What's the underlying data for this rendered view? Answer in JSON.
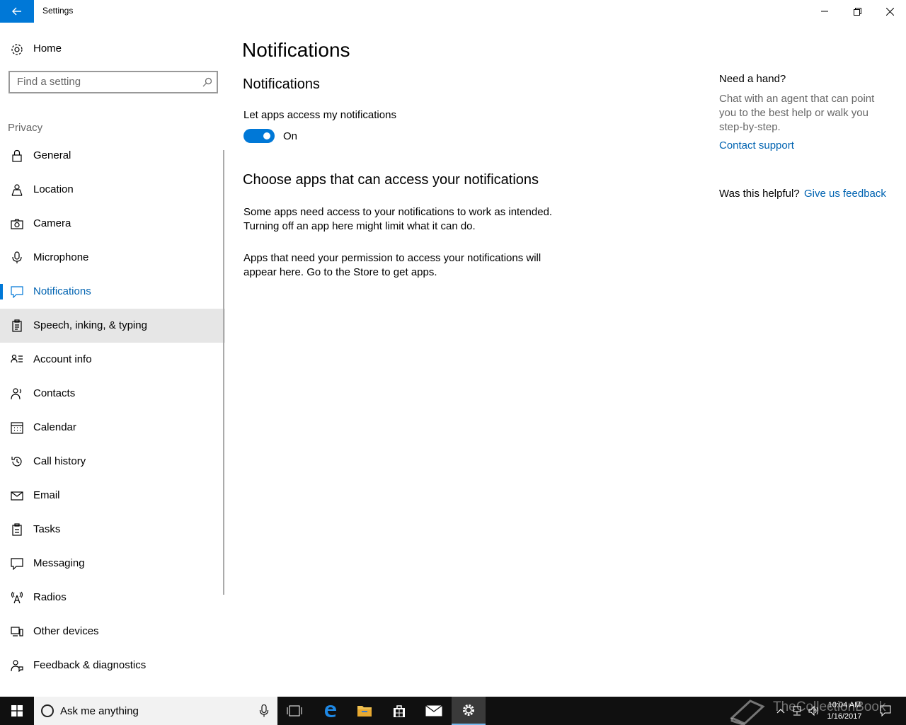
{
  "window": {
    "title": "Settings"
  },
  "sidebar": {
    "home_label": "Home",
    "search_placeholder": "Find a setting",
    "section_label": "Privacy",
    "items": [
      {
        "label": "General",
        "icon": "lock-icon"
      },
      {
        "label": "Location",
        "icon": "location-person-icon"
      },
      {
        "label": "Camera",
        "icon": "camera-icon"
      },
      {
        "label": "Microphone",
        "icon": "microphone-icon"
      },
      {
        "label": "Notifications",
        "icon": "speech-bubble-icon",
        "selected": true
      },
      {
        "label": "Speech, inking, & typing",
        "icon": "clipboard-icon",
        "hover": true
      },
      {
        "label": "Account info",
        "icon": "account-info-icon"
      },
      {
        "label": "Contacts",
        "icon": "contacts-icon"
      },
      {
        "label": "Calendar",
        "icon": "calendar-icon"
      },
      {
        "label": "Call history",
        "icon": "history-icon"
      },
      {
        "label": "Email",
        "icon": "mail-icon"
      },
      {
        "label": "Tasks",
        "icon": "tasks-icon"
      },
      {
        "label": "Messaging",
        "icon": "message-icon"
      },
      {
        "label": "Radios",
        "icon": "radio-tower-icon"
      },
      {
        "label": "Other devices",
        "icon": "devices-icon"
      },
      {
        "label": "Feedback & diagnostics",
        "icon": "feedback-icon"
      }
    ]
  },
  "main": {
    "page_title": "Notifications",
    "section_title": "Notifications",
    "toggle_label": "Let apps access my notifications",
    "toggle_state": "On",
    "toggle_on": true,
    "apps_heading": "Choose apps that can access your notifications",
    "paragraph1": "Some apps need access to your notifications to work as intended. Turning off an app here might limit what it can do.",
    "paragraph2": "Apps that need your permission to access your notifications will appear here. Go to the Store to get apps."
  },
  "help": {
    "title": "Need a hand?",
    "text": "Chat with an agent that can point you to the best help or walk you step-by-step.",
    "contact_link": "Contact support",
    "helpful_text": "Was this helpful?",
    "feedback_link": "Give us feedback"
  },
  "taskbar": {
    "search_placeholder": "Ask me anything",
    "time": "10:04 AM",
    "date": "1/16/2017",
    "watermark": "TheCollectionBook"
  },
  "colors": {
    "accent": "#0078d7",
    "link": "#0063b1",
    "taskbar": "#101010"
  }
}
